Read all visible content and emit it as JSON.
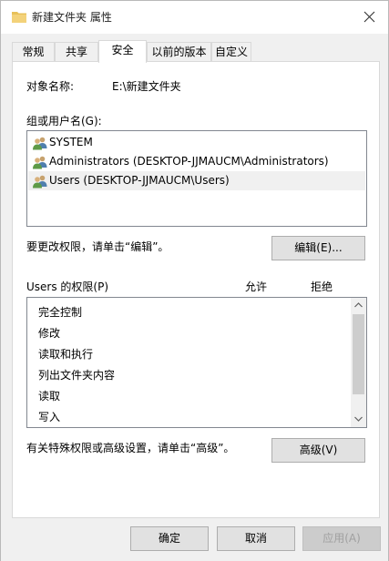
{
  "window": {
    "title": "新建文件夹 属性",
    "close_icon": "close-icon"
  },
  "tabs": [
    {
      "label": "常规",
      "active": false
    },
    {
      "label": "共享",
      "active": false
    },
    {
      "label": "安全",
      "active": true
    },
    {
      "label": "以前的版本",
      "active": false
    },
    {
      "label": "自定义",
      "active": false
    }
  ],
  "object": {
    "label": "对象名称:",
    "value": "E:\\新建文件夹"
  },
  "groups": {
    "label": "组或用户名(G):",
    "items": [
      {
        "name": "SYSTEM",
        "selected": false
      },
      {
        "name": "Administrators (DESKTOP-JJMAUCM\\Administrators)",
        "selected": false
      },
      {
        "name": "Users (DESKTOP-JJMAUCM\\Users)",
        "selected": true
      }
    ]
  },
  "edit": {
    "hint": "要更改权限，请单击“编辑”。",
    "button": "编辑(E)..."
  },
  "permissions": {
    "label": "Users 的权限(P)",
    "allow_header": "允许",
    "deny_header": "拒绝",
    "items": [
      "完全控制",
      "修改",
      "读取和执行",
      "列出文件夹内容",
      "读取",
      "写入"
    ]
  },
  "advanced": {
    "hint": "有关特殊权限或高级设置，请单击“高级”。",
    "button": "高级(V)"
  },
  "footer": {
    "ok": "确定",
    "cancel": "取消",
    "apply": "应用(A)"
  },
  "colors": {
    "selected_row": "#f0f0f0",
    "folder_icon": "#e8c15a"
  }
}
